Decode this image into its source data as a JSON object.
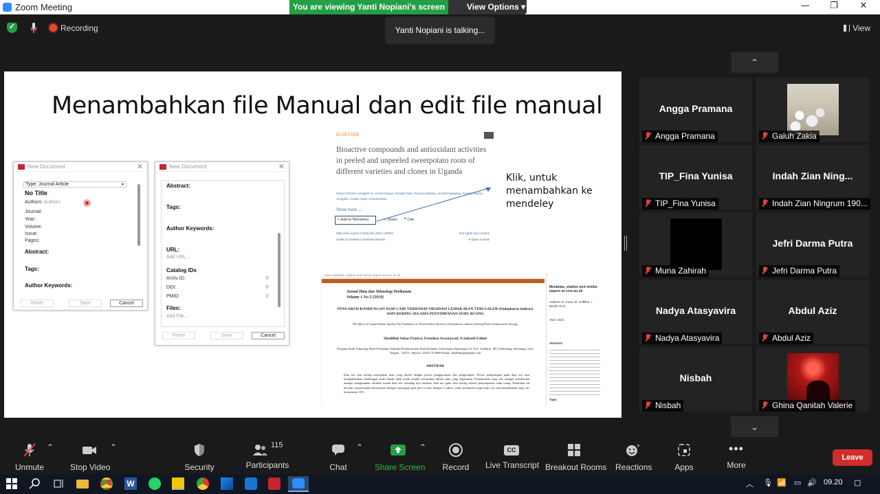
{
  "window": {
    "title": "Zoom Meeting",
    "minimize": "—",
    "maximize": "❐",
    "close": "✕"
  },
  "banner": {
    "viewing": "You are viewing Yanti Nopiani's screen",
    "view_options": "View Options ▾"
  },
  "status": {
    "recording": "Recording",
    "talking": "Yanti Nopiani is talking...",
    "view": "View"
  },
  "slide": {
    "title": "Menambahkan file Manual dan edit file manual",
    "annotation": "Klik, untuk menambahkan ke mendeley",
    "dialog1": {
      "header": "New Document",
      "type": "Type: Journal Article",
      "no_title": "No Title",
      "authors_label": "Authors:",
      "authors_value": "Authors",
      "journal": "Journal:",
      "year": "Year:",
      "volume": "Volume:",
      "issue": "Issue:",
      "pages": "Pages:",
      "abstract": "Abstract:",
      "tags": "Tags:",
      "keywords": "Author Keywords:",
      "reset": "Reset",
      "save": "Save",
      "cancel": "Cancel"
    },
    "dialog2": {
      "header": "New Document",
      "abstract": "Abstract:",
      "tags": "Tags:",
      "keywords": "Author Keywords:",
      "url": "URL:",
      "add_url": "Add URL...",
      "catalog": "Catalog IDs",
      "arxiv": "ArXiv ID:",
      "doi": "DOI:",
      "pmid": "PMID:",
      "files": "Files:",
      "add_file": "Add File...",
      "reset": "Reset",
      "save": "Save",
      "cancel": "Cancel"
    },
    "paper1": {
      "publisher": "ELSEVIER",
      "title": "Bioactive compounds and antioxidant activities in peeled and unpeeled sweetpotato roots of different varieties and clones in Uganda",
      "authors": "Hana Christine Amagloh ✉, Arnold Kaaya, Ronald Yada, Dorcas Mukasa, Arnold Katungisa, Francis Kweku Amagloh, Custer Atiyio Tumuhimbise",
      "show_more": "Show more ⌄",
      "add": "+ Add to Mendeley",
      "share": "≺ Share",
      "cite": "❞ Cite",
      "doi": "https://doi.org/10.1016/j.fufo.2022.100081",
      "license": "Under a Creative Commons license",
      "rights": "Get rights and content",
      "oa": "● Open access"
    },
    "paper2": {
      "strip": "View metadata, citation and similar papers at core.ac.uk",
      "journal": "Jurnal Ilmu dan Teknologi Perikanan",
      "volume": "Volume 1 No 2 (2019)",
      "title": "PENGARUH KANDUNGAN ASAP CAIR TERHADAP OKSIDASI LEMAK IKAN TERI GALER (Stolephorus indicus) ASIN KERING SELAMA PENYIMPANAN SUHU RUANG",
      "english": "The Effect of Liquid Smoke Against Fat Oxidation on Dried Salted Anchovy (Stolephorus indicus) During Room Temperature Storage",
      "authors": "Shadillah Sekar Pratiwi, Fronthea Swastawati, A Suhaeli Fahmi",
      "affiliation": "Program Studi Teknologi Hasil Perikanan, Fakultas Perikanan dan Ilmu Kelautan, Universitas Diponegoro Jl. Prof. Soedarto, SH, Tembalang, Semarang, Jawa Tengah – 50275, Telp/fax: (024) 7474698 Email: shadillahsp@gmail.com",
      "abstrak": "ABSTRAK",
      "abstract_text": "Ikan teri asin kering merupakan ikan yang diolah dengan proses penggaraman dan pengeringan. Proses pengeringan pada ikan teri asin mengakibatkan kandungan asam lemak tidak jenuh mudah teroksidasi akibat suhu yang digunakan. Penambahan asap cair sebagai antioksidan mampu menghambat oksidasi lemak ikan teri terhadap laju oksidasi ikan teri galer asin kering selama penyimpanan suhu ruang. Penelitian ini bersifat experimental laboratories dengan rancangan split plot in time dengan 2 faktor, yakni perlakuan tanpa asap cair dan penambahan asap cair konsentrasi 10%",
      "side_title": "Metadata, citation and similar papers at core.ac.uk",
      "side_authors": "Authors: D. Kusa, M. Griffiths, I. Binder et al.",
      "side_year": "Year: 2021",
      "side_abstract": "Abstract:",
      "side_tags": "Tags:"
    }
  },
  "gallery": [
    {
      "big": "Angga Pramana",
      "label": "Angga Pramana"
    },
    {
      "big": "",
      "label": "Galuh Zakia"
    },
    {
      "big": "TIP_Fina Yunisa",
      "label": "TIP_Fina Yunisa"
    },
    {
      "big": "Indah Zian Ning...",
      "label": "Indah Zian Ningrum 190..."
    },
    {
      "big": "",
      "label": "Muna Zahirah"
    },
    {
      "big": "Jefri Darma Putra",
      "label": "Jefri Darma Putra"
    },
    {
      "big": "Nadya Atasyavira",
      "label": "Nadya Atasyavira"
    },
    {
      "big": "Abdul Aziz",
      "label": "Abdul Aziz"
    },
    {
      "big": "Nisbah",
      "label": "Nisbah"
    },
    {
      "big": "",
      "label": "Ghina Qanitah Valerie"
    }
  ],
  "toolbar": {
    "unmute": "Unmute",
    "stop_video": "Stop Video",
    "security": "Security",
    "participants": "Participants",
    "participants_count": "115",
    "chat": "Chat",
    "share": "Share Screen",
    "record": "Record",
    "transcript": "Live Transcript",
    "breakout": "Breakout Rooms",
    "reactions": "Reactions",
    "apps": "Apps",
    "more": "More",
    "leave": "Leave",
    "cc": "CC"
  },
  "taskbar": {
    "time": "09.20"
  },
  "colors": {
    "share_green": "#23a045",
    "leave_red": "#d02d2d",
    "zoom_blue": "#2d8cff"
  }
}
